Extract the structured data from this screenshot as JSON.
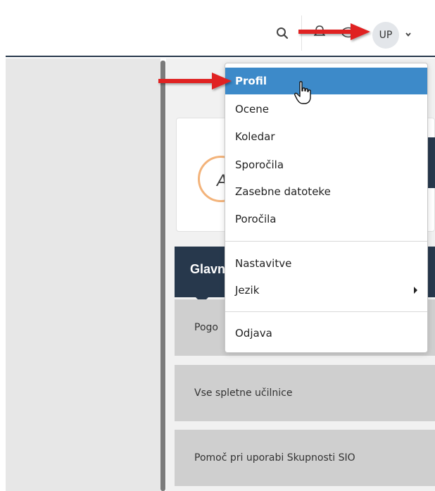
{
  "header": {
    "avatar_initials": "UP"
  },
  "icons": {
    "search": "search-icon",
    "notification": "bell-icon",
    "messages": "chat-icon",
    "user_menu_toggle": "chevron-down-icon",
    "tile": "broadcast-icon",
    "pointer": "hand-cursor-icon"
  },
  "dropdown": {
    "items": [
      {
        "label": "Profil"
      },
      {
        "label": "Ocene"
      },
      {
        "label": "Koledar"
      },
      {
        "label": "Sporočila"
      },
      {
        "label": "Zasebne datoteke"
      },
      {
        "label": "Poročila"
      },
      {
        "label": "Nastavitve"
      },
      {
        "label": "Jezik"
      },
      {
        "label": "Odjava"
      }
    ]
  },
  "card": {
    "letter": "A"
  },
  "main_nav": {
    "title_fragment": "Glavn",
    "rows": [
      {
        "label": "Pogo"
      },
      {
        "label": "Vse spletne učilnice"
      },
      {
        "label": "Pomoč pri uporabi Skupnosti SIO"
      }
    ]
  },
  "colors": {
    "navbar_border": "#27384c",
    "active_item": "#3d8ac9",
    "dark_tile": "#27384c",
    "nav_row": "#cfcfcf",
    "annotation_arrow": "#e02020"
  }
}
